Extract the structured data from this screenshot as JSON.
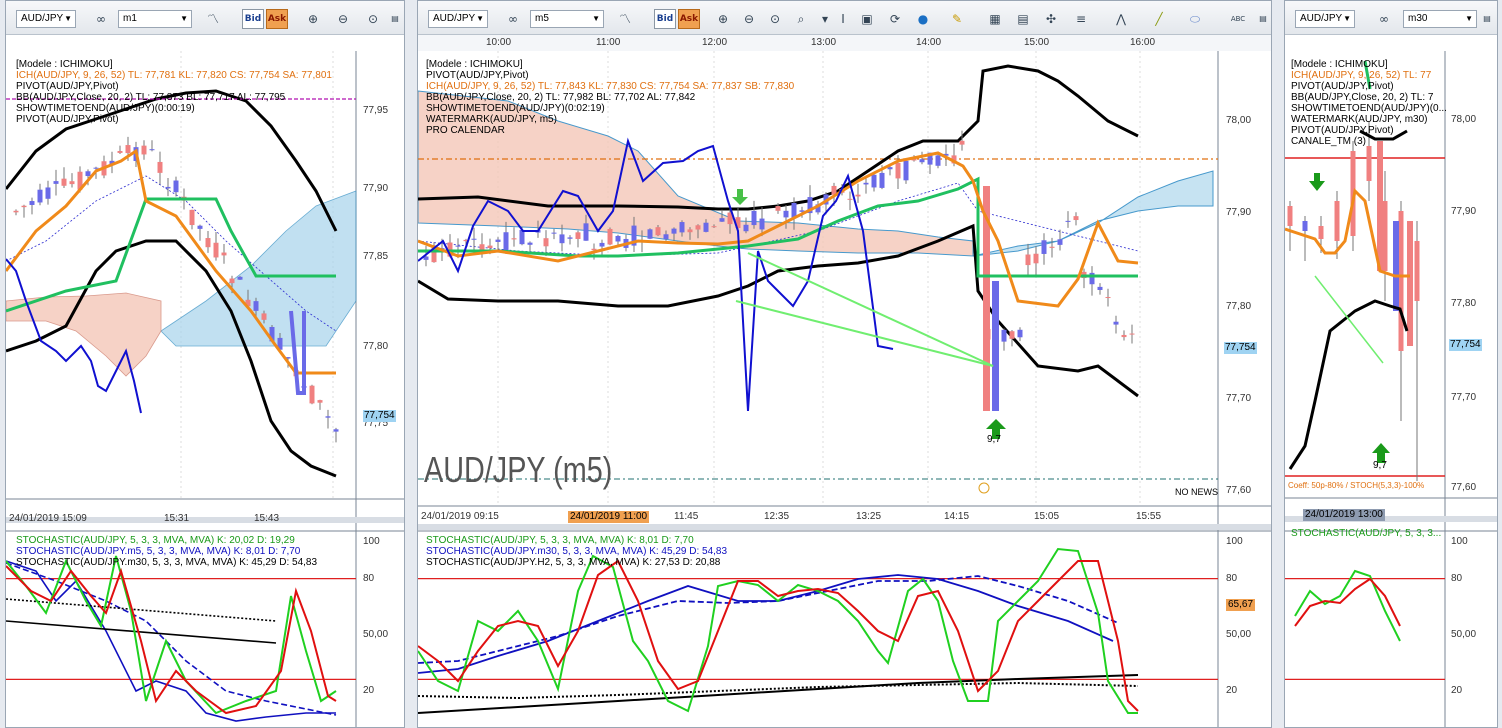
{
  "windows": [
    {
      "symbol": "AUD/JPY",
      "timeframe": "m1",
      "legend": [
        {
          "text": "[Modele : ICHIMOKU]",
          "color": "#000"
        },
        {
          "text": "ICH(AUD/JPY, 9, 26, 52)  TL: 77,781  KL: 77,820  CS: 77,754  SA: 77,801",
          "color": "#e07010"
        },
        {
          "text": "PIVOT(AUD/JPY,Pivot)",
          "color": "#000"
        },
        {
          "text": "BB(AUD/JPY,Close, 20, 2)  TL: 77,873  BL: 77,717  AL: 77,795",
          "color": "#000"
        },
        {
          "text": "SHOWTIMETOEND(AUD/JPY)(0:00:19)",
          "color": "#000"
        },
        {
          "text": "PIVOT(AUD/JPY,Pivot)",
          "color": "#000"
        }
      ],
      "y_labels": [
        "77,95",
        "77,90",
        "77,85",
        "77,80",
        "77,75"
      ],
      "x_labels": [
        "24/01/2019 15:09",
        "15:31",
        "15:43"
      ],
      "price_tag": "77,754",
      "osc_legend": [
        {
          "text": "STOCHASTIC(AUD/JPY, 5, 3, 3, MVA, MVA)  K: 20,02  D: 19,29",
          "color": "#1a9a1a"
        },
        {
          "text": "STOCHASTIC(AUD/JPY.m5, 5, 3, 3, MVA, MVA)  K: 8,01  D: 7,70",
          "color": "#1010c0"
        },
        {
          "text": "STOCHASTIC(AUD/JPY.m30, 5, 3, 3, MVA, MVA)  K: 45,29  D: 54,83",
          "color": "#000"
        }
      ],
      "osc_y": [
        "100",
        "80",
        "50,00",
        "20"
      ]
    },
    {
      "symbol": "AUD/JPY",
      "timeframe": "m5",
      "legend": [
        {
          "text": "[Modele : ICHIMOKU]",
          "color": "#000"
        },
        {
          "text": "PIVOT(AUD/JPY,Pivot)",
          "color": "#000"
        },
        {
          "text": "ICH(AUD/JPY, 9, 26, 52)  TL: 77,843  KL: 77,830  CS: 77,754  SA: 77,837  SB: 77,830",
          "color": "#e07010"
        },
        {
          "text": "BB(AUD/JPY,Close, 20, 2)  TL: 77,982  BL: 77,702  AL: 77,842",
          "color": "#000"
        },
        {
          "text": "SHOWTIMETOEND(AUD/JPY)(0:02:19)",
          "color": "#000"
        },
        {
          "text": "WATERMARK(AUD/JPY, m5)",
          "color": "#000"
        },
        {
          "text": "PRO CALENDAR",
          "color": "#000"
        }
      ],
      "top_x": [
        "10:00",
        "11:00",
        "12:00",
        "13:00",
        "14:00",
        "15:00",
        "16:00"
      ],
      "y_labels": [
        "78,00",
        "77,90",
        "77,80",
        "77,70",
        "77,60"
      ],
      "x_labels": [
        "24/01/2019 09:15",
        "24/01/2019 11:00",
        "11:45",
        "12:35",
        "13:25",
        "14:15",
        "15:05",
        "15:55"
      ],
      "price_tag": "77,754",
      "watermark": "AUD/JPY (m5)",
      "arrow_label": "9,7",
      "no_news": "NO NEWS",
      "osc_legend": [
        {
          "text": "STOCHASTIC(AUD/JPY, 5, 3, 3, MVA, MVA)  K: 8,01  D: 7,70",
          "color": "#1a9a1a"
        },
        {
          "text": "STOCHASTIC(AUD/JPY.m30, 5, 3, 3, MVA, MVA)  K: 45,29  D: 54,83",
          "color": "#1010c0"
        },
        {
          "text": "STOCHASTIC(AUD/JPY.H2, 5, 3, 3, MVA, MVA)  K: 27,53  D: 20,88",
          "color": "#000"
        }
      ],
      "osc_y": [
        "100",
        "80",
        "65,67",
        "50,00",
        "20"
      ]
    },
    {
      "symbol": "AUD/JPY",
      "timeframe": "m30",
      "legend": [
        {
          "text": "[Modele : ICHIMOKU]",
          "color": "#000"
        },
        {
          "text": "ICH(AUD/JPY, 9, 26, 52)  TL: 77",
          "color": "#e07010"
        },
        {
          "text": "PIVOT(AUD/JPY,Pivot)",
          "color": "#000"
        },
        {
          "text": "BB(AUD/JPY,Close, 20, 2)  TL: 7",
          "color": "#000"
        },
        {
          "text": "SHOWTIMETOEND(AUD/JPY)(0...",
          "color": "#000"
        },
        {
          "text": "WATERMARK(AUD/JPY, m30)",
          "color": "#000"
        },
        {
          "text": "PIVOT(AUD/JPY,Pivot)",
          "color": "#000"
        },
        {
          "text": "CANALE_TM (3)",
          "color": "#000"
        }
      ],
      "y_labels": [
        "78,00",
        "77,90",
        "77,80",
        "77,70",
        "77,60"
      ],
      "x_labels": [
        "24/01/2019 13:00"
      ],
      "price_tag": "77,754",
      "arrow_label": "9,7",
      "coeff_text": "Coeff: 50p-80% / STOCH(5,3,3)-100%",
      "osc_legend": [
        {
          "text": "STOCHASTIC(AUD/JPY, 5, 3, 3...",
          "color": "#1a9a1a"
        }
      ],
      "osc_y": [
        "100",
        "80",
        "50,00",
        "20"
      ]
    }
  ],
  "toolbar": {
    "bid_label": "Bid",
    "ask_label": "Ask",
    "abc_label": "ABC"
  },
  "colors": {
    "bull": "#6a6ae8",
    "bear": "#f08080",
    "kijun": "#20c060",
    "tenkan": "#f08a1a",
    "bb": "#000",
    "chikou": "#1010d0"
  }
}
